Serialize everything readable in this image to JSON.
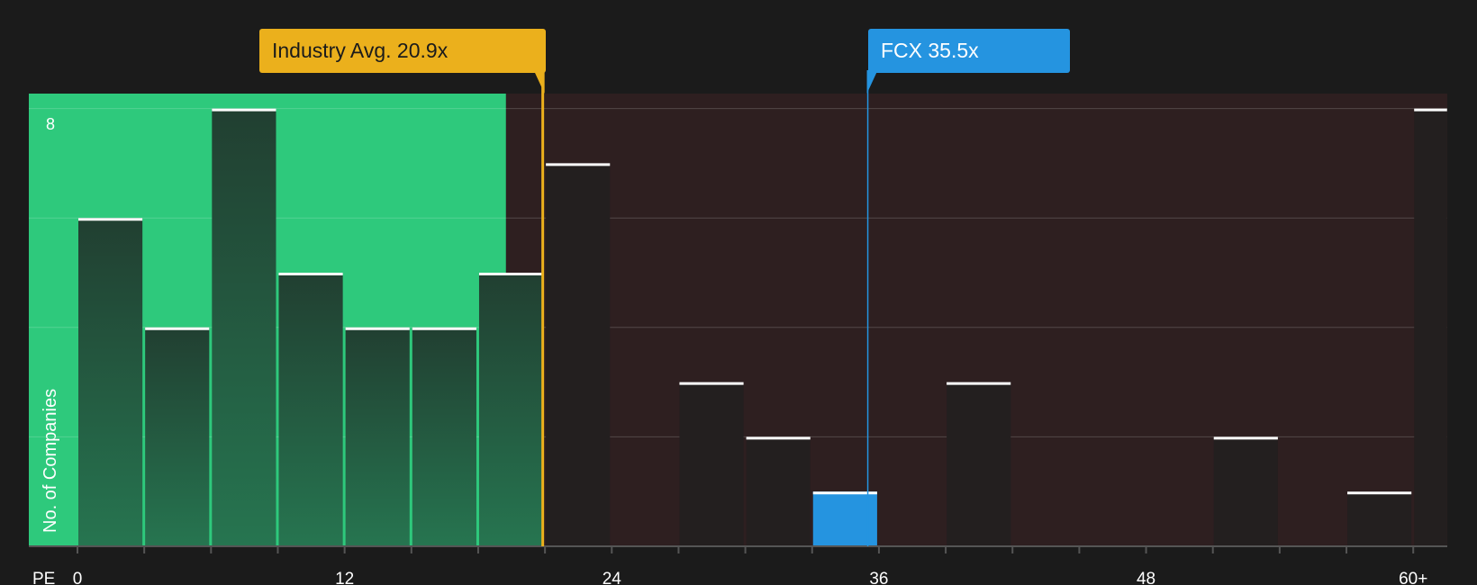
{
  "annotations": {
    "industry": {
      "label": "Industry Avg. 20.9x",
      "value": 20.9,
      "color": "#ebb01c"
    },
    "company": {
      "label": "FCX 35.5x",
      "ticker": "FCX",
      "value": 35.5,
      "color": "#2594e0"
    }
  },
  "chart_data": {
    "type": "bar",
    "title": "",
    "xlabel": "PE",
    "ylabel": "No. of Companies",
    "x_tick_labels": [
      "0",
      "12",
      "24",
      "36",
      "48",
      "60+"
    ],
    "x_tick_values": [
      0,
      12,
      24,
      36,
      48,
      60
    ],
    "y_tick_labels": [
      "8"
    ],
    "ylim": [
      0,
      8.3
    ],
    "xlim": [
      -2.2,
      61.6
    ],
    "bin_width": 3,
    "bins": [
      {
        "x0": 0,
        "x1": 3,
        "count": 6
      },
      {
        "x0": 3,
        "x1": 6,
        "count": 4
      },
      {
        "x0": 6,
        "x1": 9,
        "count": 8
      },
      {
        "x0": 9,
        "x1": 12,
        "count": 5
      },
      {
        "x0": 12,
        "x1": 15,
        "count": 4
      },
      {
        "x0": 15,
        "x1": 18,
        "count": 4
      },
      {
        "x0": 18,
        "x1": 21,
        "count": 5
      },
      {
        "x0": 21,
        "x1": 24,
        "count": 7
      },
      {
        "x0": 24,
        "x1": 27,
        "count": 0
      },
      {
        "x0": 27,
        "x1": 30,
        "count": 3
      },
      {
        "x0": 30,
        "x1": 33,
        "count": 2
      },
      {
        "x0": 33,
        "x1": 36,
        "count": 1,
        "highlight": true
      },
      {
        "x0": 36,
        "x1": 39,
        "count": 0
      },
      {
        "x0": 39,
        "x1": 42,
        "count": 3
      },
      {
        "x0": 42,
        "x1": 45,
        "count": 0
      },
      {
        "x0": 45,
        "x1": 48,
        "count": 0
      },
      {
        "x0": 48,
        "x1": 51,
        "count": 0
      },
      {
        "x0": 51,
        "x1": 54,
        "count": 2
      },
      {
        "x0": 54,
        "x1": 57,
        "count": 0
      },
      {
        "x0": 57,
        "x1": 60,
        "count": 1
      },
      {
        "x0": 60,
        "x1": 61.6,
        "count": 8
      }
    ],
    "grid": true,
    "colors": {
      "below_avg_region": "#2ec97c",
      "above_avg_region": "#2e1f20",
      "bar_in_green": "#244a37",
      "bar_in_red": "#231f1f",
      "highlight_bar": "#2594e0",
      "axis": "#555555"
    }
  }
}
